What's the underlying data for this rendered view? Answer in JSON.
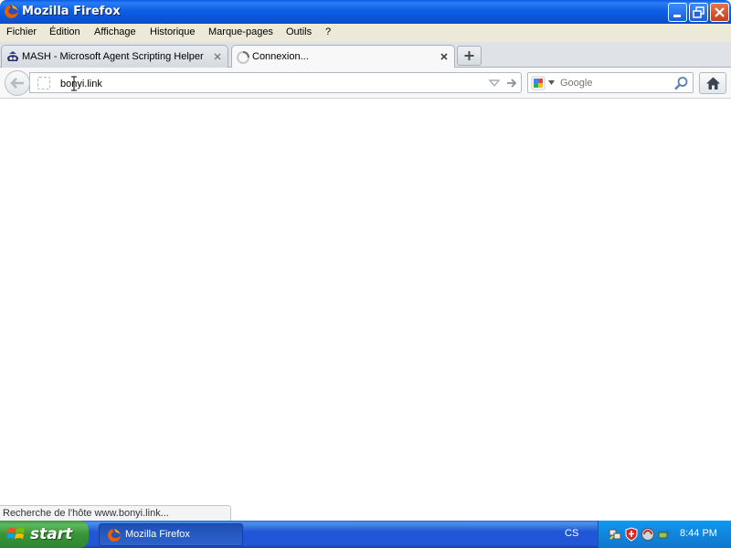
{
  "window": {
    "title": "Mozilla Firefox"
  },
  "menu": {
    "items": [
      "Fichier",
      "Édition",
      "Affichage",
      "Historique",
      "Marque-pages",
      "Outils",
      "?"
    ]
  },
  "tabs": [
    {
      "label": "MASH - Microsoft Agent Scripting Helper",
      "icon": "mash-agent-icon",
      "active": false
    },
    {
      "label": "Connexion...",
      "icon": "loading-spinner-icon",
      "active": true
    }
  ],
  "navbar": {
    "url": "bonyi.link",
    "search_placeholder": "Google"
  },
  "status": {
    "text": "Recherche de l'hôte www.bonyi.link..."
  },
  "taskbar": {
    "start_label": "start",
    "task_label": "Mozilla Firefox",
    "language": "CS",
    "clock": "8:44 PM"
  },
  "colors": {
    "titlebar_blue": "#0853d6",
    "menubar_bg": "#ece9d8",
    "taskbar_blue": "#2157d7",
    "start_green": "#399439",
    "tray_blue": "#1289e0"
  }
}
